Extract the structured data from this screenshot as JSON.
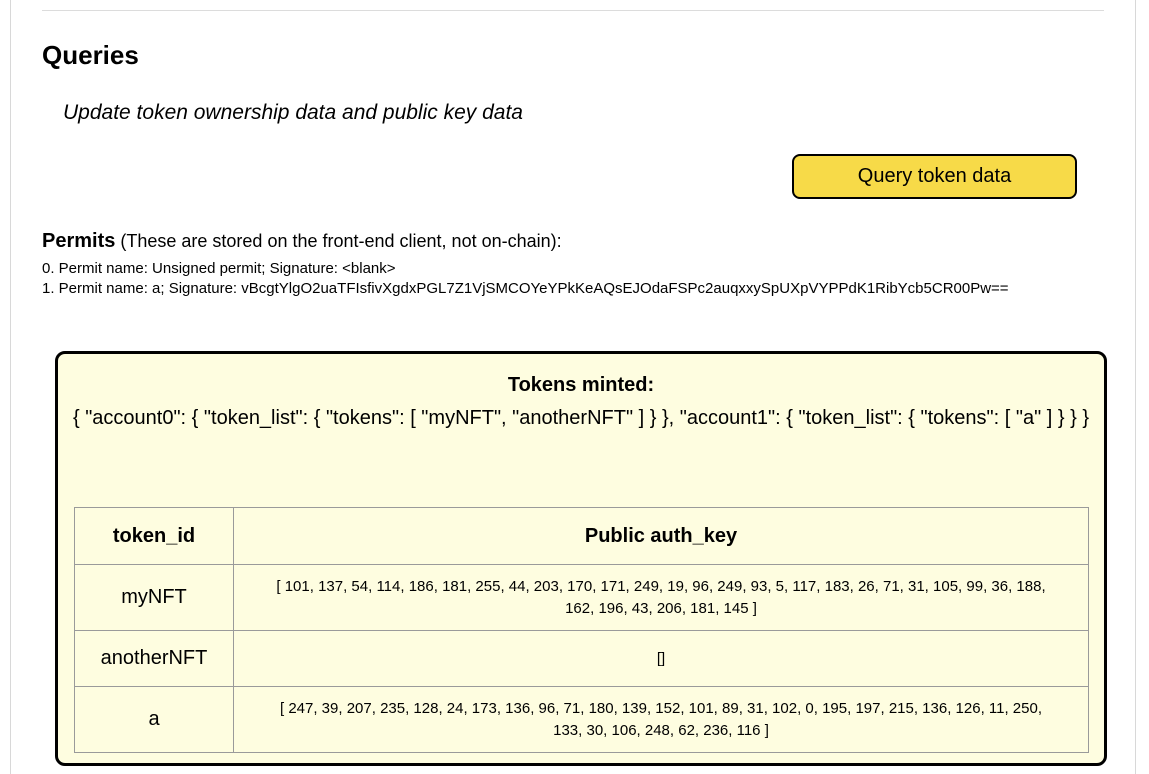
{
  "queries": {
    "title": "Queries",
    "subtitle": "Update token ownership data and public key data",
    "query_button_label": "Query token data"
  },
  "permits": {
    "heading_bold": "Permits",
    "heading_note": " (These are stored on the front-end client, not on-chain):",
    "items": [
      "0. Permit name: Unsigned permit; Signature: <blank>",
      "1. Permit name: a; Signature: vBcgtYlgO2uaTFIsfivXgdxPGL7Z1VjSMCOYeYPkKeAQsEJOdaFSPc2auqxxySpUXpVYPPdK1RibYcb5CR00Pw=="
    ]
  },
  "tokens_minted": {
    "title": "Tokens minted:",
    "json_text": "{ \"account0\": { \"token_list\": { \"tokens\": [ \"myNFT\", \"anotherNFT\" ] } }, \"account1\": { \"token_list\": { \"tokens\": [ \"a\" ] } } }"
  },
  "auth_table": {
    "headers": [
      "token_id",
      "Public auth_key"
    ],
    "rows": [
      {
        "token_id": "myNFT",
        "auth_key": "[ 101, 137, 54, 114, 186, 181, 255, 44, 203, 170, 171, 249, 19, 96, 249, 93, 5, 117, 183, 26, 71, 31, 105, 99, 36, 188, 162, 196, 43, 206, 181, 145 ]"
      },
      {
        "token_id": "anotherNFT",
        "auth_key": "[]"
      },
      {
        "token_id": "a",
        "auth_key": "[ 247, 39, 207, 235, 128, 24, 173, 136, 96, 71, 180, 139, 152, 101, 89, 31, 102, 0, 195, 197, 215, 136, 126, 11, 250, 133, 30, 106, 248, 62, 236, 116 ]"
      }
    ]
  }
}
